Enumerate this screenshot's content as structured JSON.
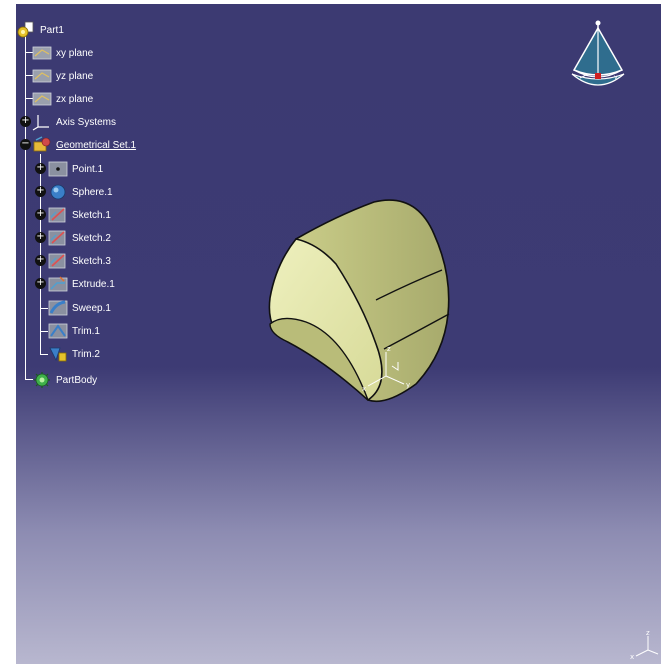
{
  "tree": {
    "root": "Part1",
    "items": [
      {
        "label": "xy plane",
        "icon": "plane-icon"
      },
      {
        "label": "yz plane",
        "icon": "plane-icon"
      },
      {
        "label": "zx plane",
        "icon": "plane-icon"
      },
      {
        "label": "Axis Systems",
        "icon": "axis-system-icon"
      },
      {
        "label": "Geometrical Set.1",
        "icon": "geometrical-set-icon"
      },
      {
        "label": "Point.1",
        "icon": "point-icon"
      },
      {
        "label": "Sphere.1",
        "icon": "sphere-icon"
      },
      {
        "label": "Sketch.1",
        "icon": "sketch-icon"
      },
      {
        "label": "Sketch.2",
        "icon": "sketch-icon"
      },
      {
        "label": "Sketch.3",
        "icon": "sketch-icon"
      },
      {
        "label": "Extrude.1",
        "icon": "extrude-icon"
      },
      {
        "label": "Sweep.1",
        "icon": "sweep-icon"
      },
      {
        "label": "Trim.1",
        "icon": "trim-icon"
      },
      {
        "label": "Trim.2",
        "icon": "trim-icon"
      },
      {
        "label": "PartBody",
        "icon": "partbody-icon"
      }
    ]
  },
  "axes": {
    "x": "x",
    "y": "y",
    "z": "z"
  },
  "colors": {
    "background_top": "#3c3a72",
    "background_bottom": "#b8b7cf",
    "model_fill": "#e8ebb4",
    "compass_blue": "#2f6d8e"
  }
}
